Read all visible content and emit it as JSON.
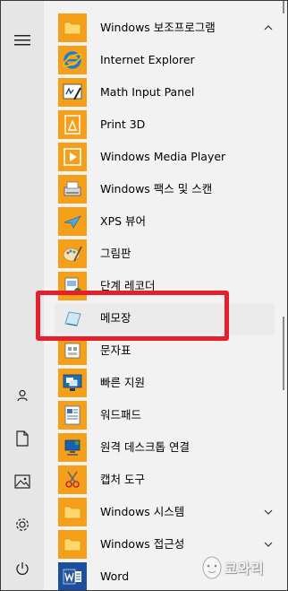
{
  "rail": [
    {
      "icon": "hamburger-icon"
    },
    {
      "icon": "user-icon"
    },
    {
      "icon": "document-icon"
    },
    {
      "icon": "pictures-icon"
    },
    {
      "icon": "settings-icon"
    },
    {
      "icon": "power-icon"
    }
  ],
  "list": {
    "group_header": {
      "label": "Windows 보조프로그램",
      "expanded": true
    },
    "apps": [
      {
        "label": "Internet Explorer",
        "icon": "internet-explorer-icon"
      },
      {
        "label": "Math Input Panel",
        "icon": "math-input-icon"
      },
      {
        "label": "Print 3D",
        "icon": "print-3d-icon"
      },
      {
        "label": "Windows Media Player",
        "icon": "media-player-icon"
      },
      {
        "label": "Windows 팩스 및 스캔",
        "icon": "fax-scan-icon"
      },
      {
        "label": "XPS 뷰어",
        "icon": "xps-viewer-icon"
      },
      {
        "label": "그림판",
        "icon": "paint-icon"
      },
      {
        "label": "단계 레코더",
        "icon": "steps-recorder-icon"
      },
      {
        "label": "메모장",
        "icon": "notepad-icon",
        "selected": true
      },
      {
        "label": "문자표",
        "icon": "character-map-icon"
      },
      {
        "label": "빠른 지원",
        "icon": "quick-assist-icon"
      },
      {
        "label": "워드패드",
        "icon": "wordpad-icon"
      },
      {
        "label": "원격 데스크톱 연결",
        "icon": "remote-desktop-icon"
      },
      {
        "label": "캡처 도구",
        "icon": "snipping-tool-icon"
      }
    ],
    "folders": [
      {
        "label": "Windows 시스템",
        "icon": "folder-icon"
      },
      {
        "label": "Windows 접근성",
        "icon": "folder-icon"
      }
    ],
    "word": {
      "label": "Word",
      "icon": "word-icon"
    }
  },
  "watermark": {
    "text": "코와리"
  },
  "colors": {
    "tile": "#f6a01a",
    "highlight": "#e5202c",
    "rail": "#e6e6e6",
    "list_bg": "#f2f2f2"
  }
}
